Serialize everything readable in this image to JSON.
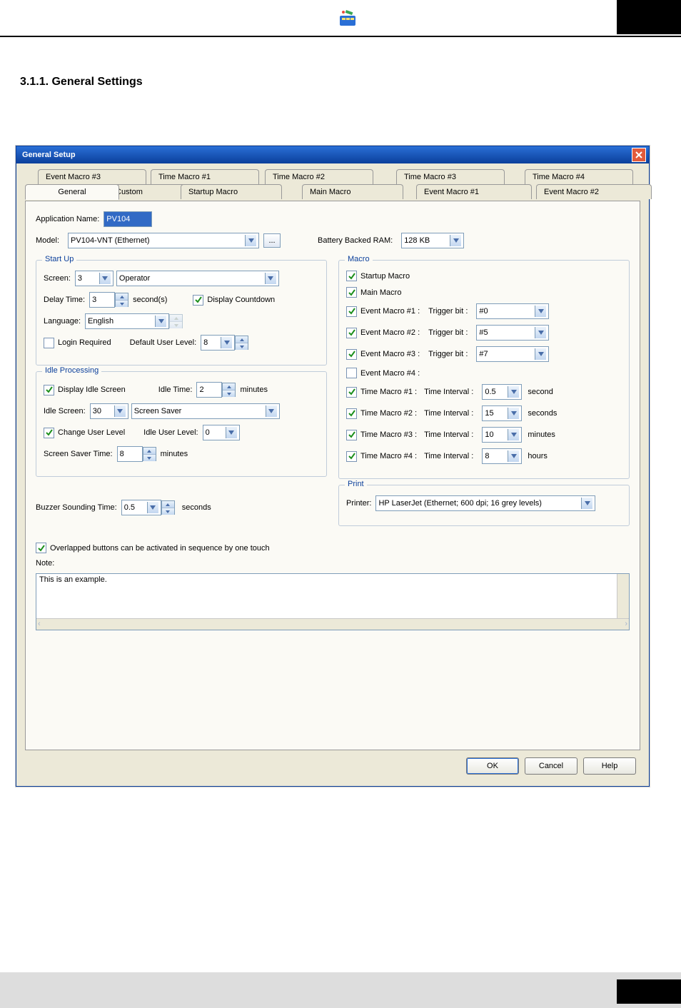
{
  "section_heading": "3.1.1. General Settings",
  "dialog_title": "General Setup",
  "tabs_row1": [
    "Event Macro #3",
    "Time Macro #1",
    "Time Macro #2",
    "Time Macro #3",
    "Time Macro #4"
  ],
  "tabs_row2": [
    "General",
    "Custom",
    "Startup Macro",
    "Main Macro",
    "Event Macro #1",
    "Event Macro #2"
  ],
  "app_name_label": "Application Name:",
  "app_name_value": "PV104",
  "model_label": "Model:",
  "model_value": "PV104-VNT (Ethernet)",
  "bbram_label": "Battery Backed RAM:",
  "bbram_value": "128 KB",
  "startup": {
    "legend": "Start Up",
    "screen_label": "Screen:",
    "screen_value": "3",
    "screen_text": "Operator",
    "delay_label": "Delay Time:",
    "delay_value": "3",
    "delay_unit": "second(s)",
    "countdown_label": "Display Countdown",
    "language_label": "Language:",
    "language_value": "English",
    "login_label": "Login Required",
    "default_user_label": "Default User Level:",
    "default_user_value": "8"
  },
  "idle": {
    "legend": "Idle Processing",
    "display_idle_label": "Display Idle Screen",
    "idle_time_label": "Idle Time:",
    "idle_time_value": "2",
    "idle_time_unit": "minutes",
    "idle_screen_label": "Idle Screen:",
    "idle_screen_value": "30",
    "idle_screen_text": "Screen Saver",
    "change_user_label": "Change User Level",
    "idle_user_label": "Idle User Level:",
    "idle_user_value": "0",
    "saver_label": "Screen Saver Time:",
    "saver_value": "8",
    "saver_unit": "minutes"
  },
  "buzzer": {
    "label": "Buzzer Sounding Time:",
    "value": "0.5",
    "unit": "seconds"
  },
  "macro": {
    "legend": "Macro",
    "startup": "Startup Macro",
    "main": "Main Macro",
    "e1_label": "Event Macro #1 :",
    "e2_label": "Event Macro #2 :",
    "e3_label": "Event Macro #3 :",
    "e4_label": "Event Macro #4 :",
    "trigger_label": "Trigger bit :",
    "e1_val": "#0",
    "e2_val": "#5",
    "e3_val": "#7",
    "t1_label": "Time Macro #1 :",
    "t2_label": "Time Macro #2 :",
    "t3_label": "Time Macro #3 :",
    "t4_label": "Time Macro #4 :",
    "interval_label": "Time Interval :",
    "t1_val": "0.5",
    "t1_unit": "second",
    "t2_val": "15",
    "t2_unit": "seconds",
    "t3_val": "10",
    "t3_unit": "minutes",
    "t4_val": "8",
    "t4_unit": "hours"
  },
  "print": {
    "legend": "Print",
    "label": "Printer:",
    "value": "HP LaserJet (Ethernet; 600 dpi; 16 grey levels)"
  },
  "overlap_label": "Overlapped buttons can be activated in sequence by one touch",
  "note_label": "Note:",
  "note_text": "This is an example.",
  "buttons": {
    "ok": "OK",
    "cancel": "Cancel",
    "help": "Help"
  }
}
